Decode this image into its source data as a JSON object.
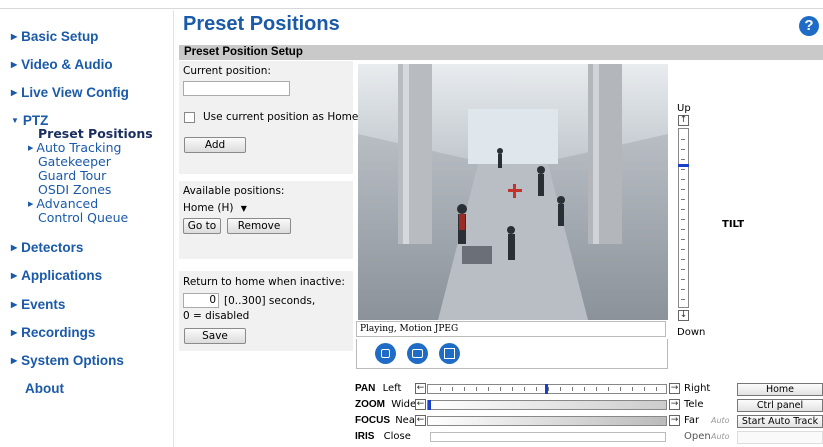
{
  "page_title": "Preset Positions",
  "section_title": "Preset Position Setup",
  "sidebar": {
    "items": [
      {
        "label": "Basic Setup"
      },
      {
        "label": "Video & Audio"
      },
      {
        "label": "Live View Config"
      },
      {
        "label": "PTZ"
      },
      {
        "label": "Detectors"
      },
      {
        "label": "Applications"
      },
      {
        "label": "Events"
      },
      {
        "label": "Recordings"
      },
      {
        "label": "System Options"
      },
      {
        "label": "About"
      }
    ],
    "ptz_sub": [
      {
        "label": "Preset Positions",
        "active": true
      },
      {
        "label": "Auto Tracking"
      },
      {
        "label": "Gatekeeper"
      },
      {
        "label": "Guard Tour"
      },
      {
        "label": "OSDI Zones"
      },
      {
        "label": "Advanced"
      },
      {
        "label": "Control Queue"
      }
    ]
  },
  "setup": {
    "current_position_label": "Current position:",
    "current_position_value": "",
    "use_as_home_label": "Use current position as Home",
    "add_label": "Add",
    "available_label": "Available positions:",
    "available_selected": "Home (H)",
    "goto_label": "Go to",
    "remove_label": "Remove",
    "return_label": "Return to home when inactive:",
    "return_value": "0",
    "return_range": "[0..300] seconds,",
    "return_note": "0 = disabled",
    "save_label": "Save"
  },
  "video": {
    "status": "Playing, Motion JPEG"
  },
  "tilt": {
    "up": "Up",
    "down": "Down",
    "label": "TILT",
    "level": 0.2
  },
  "ptz": {
    "pan": {
      "name": "PAN",
      "left": "Left",
      "right": "Right",
      "level": 0.5
    },
    "zoom": {
      "name": "ZOOM",
      "left": "Wide",
      "right": "Tele",
      "level": 0.0
    },
    "focus": {
      "name": "FOCUS",
      "left": "Near",
      "right": "Far",
      "auto": "Auto"
    },
    "iris": {
      "name": "IRIS",
      "left": "Close",
      "right": "Open",
      "auto": "Auto"
    }
  },
  "buttons": {
    "home": "Home",
    "ctrl_panel": "Ctrl panel",
    "start_auto_track": "Start Auto Track"
  },
  "colors": {
    "accent": "#1a5aa8",
    "button_blue": "#1f6cc7"
  }
}
